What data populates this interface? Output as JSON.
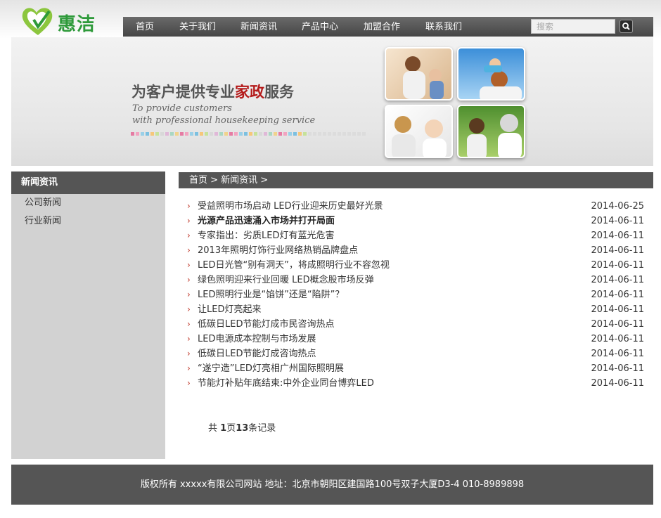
{
  "logo": {
    "text": "惠洁",
    "icon": "heart-logo-icon",
    "color": "#2e9a3a"
  },
  "nav": {
    "items": [
      "首页",
      "关于我们",
      "新闻资讯",
      "产品中心",
      "加盟合作",
      "联系我们"
    ]
  },
  "search": {
    "placeholder": "搜索",
    "button_icon": "search-icon"
  },
  "banner": {
    "title_prefix": "为客户提供专业",
    "title_highlight": "家政",
    "title_suffix": "服务",
    "subtitle_line1": "To provide customers",
    "subtitle_line2": "with professional housekeeping service",
    "accent_color": "#b41a1a"
  },
  "sidebar": {
    "title": "新闻资讯",
    "items": [
      "公司新闻",
      "行业新闻"
    ]
  },
  "breadcrumb": {
    "text": "首页 > 新闻资讯 >"
  },
  "news": [
    {
      "title": "受益照明市场启动 LED行业迎来历史最好光景",
      "date": "2014-06-25"
    },
    {
      "title": "光源产品迅速涌入市场并打开局面",
      "date": "2014-06-11"
    },
    {
      "title": "专家指出：劣质LED灯有蓝光危害",
      "date": "2014-06-11"
    },
    {
      "title": "2013年照明灯饰行业网络热销品牌盘点",
      "date": "2014-06-11"
    },
    {
      "title": "LED日光管“别有洞天”，将成照明行业不容忽视",
      "date": "2014-06-11"
    },
    {
      "title": "绿色照明迎来行业回暖 LED概念股市场反弹",
      "date": "2014-06-11"
    },
    {
      "title": "LED照明行业是“馅饼”还是“陷阱”？",
      "date": "2014-06-11"
    },
    {
      "title": "让LED灯亮起来",
      "date": "2014-06-11"
    },
    {
      "title": "低碳日LED节能灯成市民咨询热点",
      "date": "2014-06-11"
    },
    {
      "title": "LED电源成本控制与市场发展",
      "date": "2014-06-11"
    },
    {
      "title": "低碳日LED节能灯成咨询热点",
      "date": "2014-06-11"
    },
    {
      "title": "“遂宁造”LED灯亮相广州国际照明展",
      "date": "2014-06-11"
    },
    {
      "title": "节能灯补贴年底结束:中外企业同台博弈LED",
      "date": "2014-06-11"
    }
  ],
  "pager": {
    "prefix": "共 ",
    "pages": "1",
    "mid": "页",
    "count": "13",
    "suffix": "条记录"
  },
  "footer": {
    "text": "版权所有 xxxxx有限公司网站 地址：北京市朝阳区建国路100号双子大厦D3-4 010-8989898"
  }
}
